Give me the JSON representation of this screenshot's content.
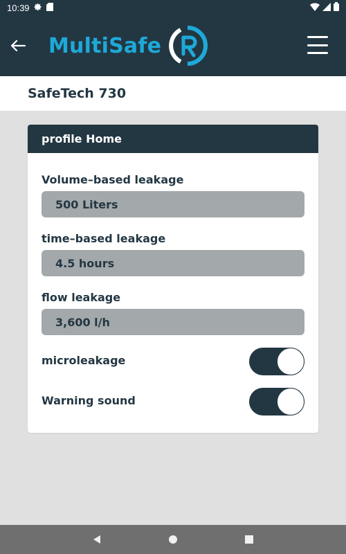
{
  "status_bar": {
    "time": "10:39"
  },
  "app_bar": {
    "logo_text": "MultiSafe",
    "colors": {
      "background": "#233743",
      "logo": "#1ea9d8"
    }
  },
  "device": {
    "name": "SafeTech 730"
  },
  "profile_card": {
    "title": "profile Home",
    "fields": [
      {
        "label": "Volume–based leakage",
        "value": "500 Liters"
      },
      {
        "label": "time–based leakage",
        "value": "4.5 hours"
      },
      {
        "label": "flow leakage",
        "value": "3,600 l/h"
      }
    ],
    "toggles": [
      {
        "label": "microleakage",
        "state": "on"
      },
      {
        "label": "Warning sound",
        "state": "on"
      }
    ]
  }
}
